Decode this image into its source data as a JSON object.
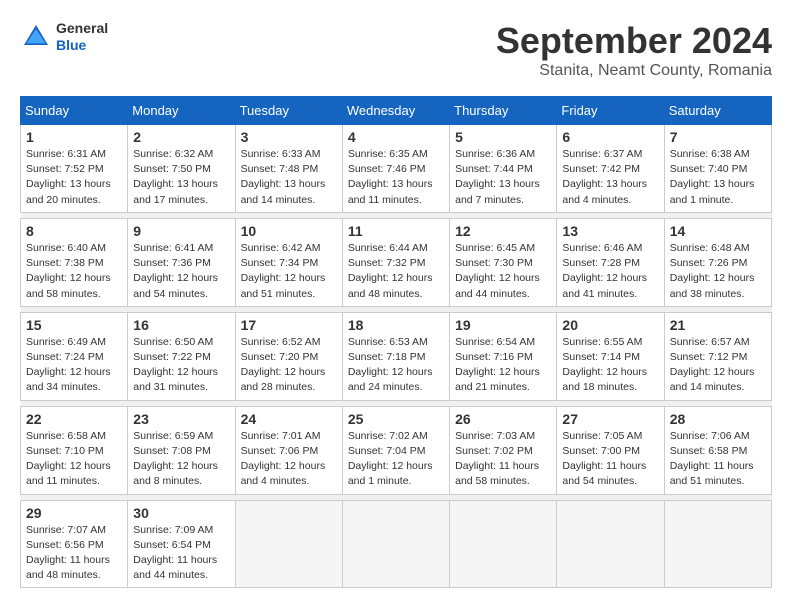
{
  "logo": {
    "general": "General",
    "blue": "Blue"
  },
  "header": {
    "month": "September 2024",
    "location": "Stanita, Neamt County, Romania"
  },
  "days_of_week": [
    "Sunday",
    "Monday",
    "Tuesday",
    "Wednesday",
    "Thursday",
    "Friday",
    "Saturday"
  ],
  "weeks": [
    [
      {
        "day": 1,
        "info": "Sunrise: 6:31 AM\nSunset: 7:52 PM\nDaylight: 13 hours\nand 20 minutes."
      },
      {
        "day": 2,
        "info": "Sunrise: 6:32 AM\nSunset: 7:50 PM\nDaylight: 13 hours\nand 17 minutes."
      },
      {
        "day": 3,
        "info": "Sunrise: 6:33 AM\nSunset: 7:48 PM\nDaylight: 13 hours\nand 14 minutes."
      },
      {
        "day": 4,
        "info": "Sunrise: 6:35 AM\nSunset: 7:46 PM\nDaylight: 13 hours\nand 11 minutes."
      },
      {
        "day": 5,
        "info": "Sunrise: 6:36 AM\nSunset: 7:44 PM\nDaylight: 13 hours\nand 7 minutes."
      },
      {
        "day": 6,
        "info": "Sunrise: 6:37 AM\nSunset: 7:42 PM\nDaylight: 13 hours\nand 4 minutes."
      },
      {
        "day": 7,
        "info": "Sunrise: 6:38 AM\nSunset: 7:40 PM\nDaylight: 13 hours\nand 1 minute."
      }
    ],
    [
      {
        "day": 8,
        "info": "Sunrise: 6:40 AM\nSunset: 7:38 PM\nDaylight: 12 hours\nand 58 minutes."
      },
      {
        "day": 9,
        "info": "Sunrise: 6:41 AM\nSunset: 7:36 PM\nDaylight: 12 hours\nand 54 minutes."
      },
      {
        "day": 10,
        "info": "Sunrise: 6:42 AM\nSunset: 7:34 PM\nDaylight: 12 hours\nand 51 minutes."
      },
      {
        "day": 11,
        "info": "Sunrise: 6:44 AM\nSunset: 7:32 PM\nDaylight: 12 hours\nand 48 minutes."
      },
      {
        "day": 12,
        "info": "Sunrise: 6:45 AM\nSunset: 7:30 PM\nDaylight: 12 hours\nand 44 minutes."
      },
      {
        "day": 13,
        "info": "Sunrise: 6:46 AM\nSunset: 7:28 PM\nDaylight: 12 hours\nand 41 minutes."
      },
      {
        "day": 14,
        "info": "Sunrise: 6:48 AM\nSunset: 7:26 PM\nDaylight: 12 hours\nand 38 minutes."
      }
    ],
    [
      {
        "day": 15,
        "info": "Sunrise: 6:49 AM\nSunset: 7:24 PM\nDaylight: 12 hours\nand 34 minutes."
      },
      {
        "day": 16,
        "info": "Sunrise: 6:50 AM\nSunset: 7:22 PM\nDaylight: 12 hours\nand 31 minutes."
      },
      {
        "day": 17,
        "info": "Sunrise: 6:52 AM\nSunset: 7:20 PM\nDaylight: 12 hours\nand 28 minutes."
      },
      {
        "day": 18,
        "info": "Sunrise: 6:53 AM\nSunset: 7:18 PM\nDaylight: 12 hours\nand 24 minutes."
      },
      {
        "day": 19,
        "info": "Sunrise: 6:54 AM\nSunset: 7:16 PM\nDaylight: 12 hours\nand 21 minutes."
      },
      {
        "day": 20,
        "info": "Sunrise: 6:55 AM\nSunset: 7:14 PM\nDaylight: 12 hours\nand 18 minutes."
      },
      {
        "day": 21,
        "info": "Sunrise: 6:57 AM\nSunset: 7:12 PM\nDaylight: 12 hours\nand 14 minutes."
      }
    ],
    [
      {
        "day": 22,
        "info": "Sunrise: 6:58 AM\nSunset: 7:10 PM\nDaylight: 12 hours\nand 11 minutes."
      },
      {
        "day": 23,
        "info": "Sunrise: 6:59 AM\nSunset: 7:08 PM\nDaylight: 12 hours\nand 8 minutes."
      },
      {
        "day": 24,
        "info": "Sunrise: 7:01 AM\nSunset: 7:06 PM\nDaylight: 12 hours\nand 4 minutes."
      },
      {
        "day": 25,
        "info": "Sunrise: 7:02 AM\nSunset: 7:04 PM\nDaylight: 12 hours\nand 1 minute."
      },
      {
        "day": 26,
        "info": "Sunrise: 7:03 AM\nSunset: 7:02 PM\nDaylight: 11 hours\nand 58 minutes."
      },
      {
        "day": 27,
        "info": "Sunrise: 7:05 AM\nSunset: 7:00 PM\nDaylight: 11 hours\nand 54 minutes."
      },
      {
        "day": 28,
        "info": "Sunrise: 7:06 AM\nSunset: 6:58 PM\nDaylight: 11 hours\nand 51 minutes."
      }
    ],
    [
      {
        "day": 29,
        "info": "Sunrise: 7:07 AM\nSunset: 6:56 PM\nDaylight: 11 hours\nand 48 minutes."
      },
      {
        "day": 30,
        "info": "Sunrise: 7:09 AM\nSunset: 6:54 PM\nDaylight: 11 hours\nand 44 minutes."
      },
      null,
      null,
      null,
      null,
      null
    ]
  ]
}
